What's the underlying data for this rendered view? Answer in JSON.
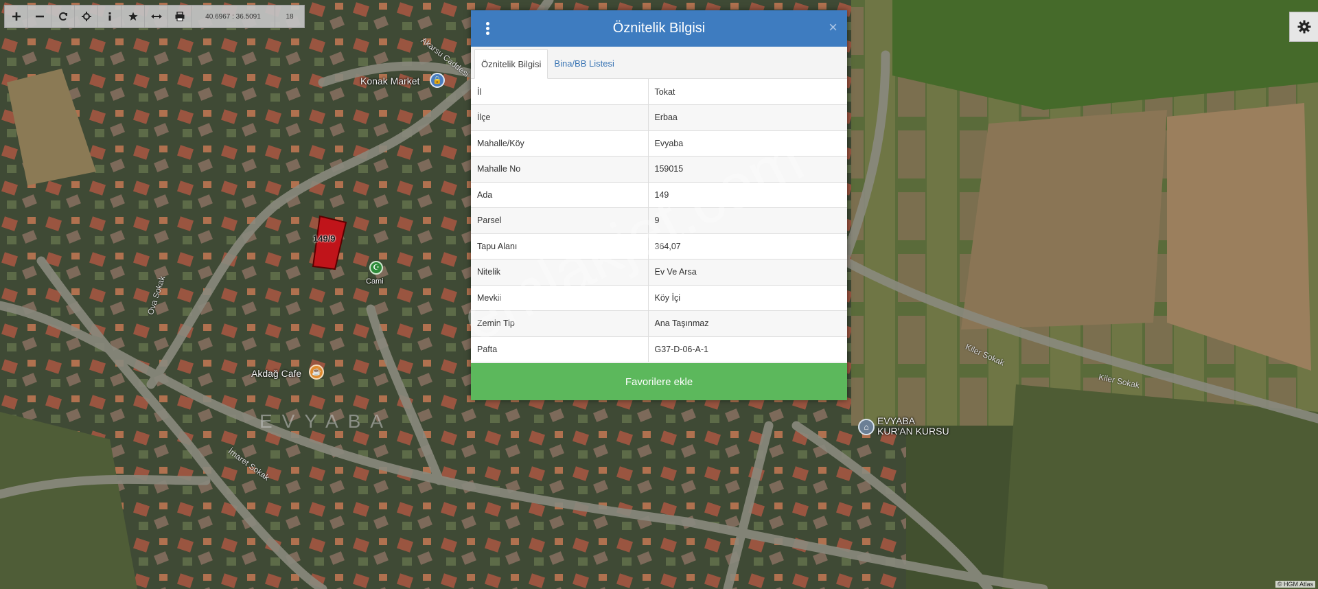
{
  "toolbar": {
    "buttons": [
      {
        "name": "zoom-in",
        "icon": "plus-icon"
      },
      {
        "name": "zoom-out",
        "icon": "minus-icon"
      },
      {
        "name": "refresh",
        "icon": "refresh-icon"
      },
      {
        "name": "locate",
        "icon": "crosshair-icon"
      },
      {
        "name": "info",
        "icon": "info-icon"
      },
      {
        "name": "favorites",
        "icon": "star-icon"
      },
      {
        "name": "measure",
        "icon": "measure-icon"
      },
      {
        "name": "print",
        "icon": "print-icon"
      }
    ],
    "coordinates": "40.6967 : 36.5091",
    "zoom_level": "18"
  },
  "map": {
    "parcel_label": "149/9",
    "places": {
      "konak_market": "Konak Market",
      "cami": "Cami",
      "akdag_cafe": "Akdağ Cafe",
      "evyaba": "EVYABA",
      "kuran_kursu_line1": "EVYABA",
      "kuran_kursu_line2": "KUR'AN KURSU"
    },
    "roads": {
      "akarsu": "Akarsu Caddesi",
      "ova": "Ova Sokak",
      "imaret": "İmaret Sokak",
      "kiler1": "Kiler Sokak",
      "kiler2": "Kiler Sokak"
    },
    "attribution": "© HGM Atlas",
    "watermark": "emlakjet.com",
    "colors": {
      "parcel_fill": "#c0141a",
      "parcel_border": "#5a0000"
    }
  },
  "dialog": {
    "title": "Öznitelik Bilgisi",
    "close_symbol": "×",
    "tabs": [
      {
        "label": "Öznitelik Bilgisi",
        "active": true
      },
      {
        "label": "Bina/BB Listesi",
        "active": false
      }
    ],
    "rows": [
      {
        "key": "İl",
        "value": "Tokat"
      },
      {
        "key": "İlçe",
        "value": "Erbaa"
      },
      {
        "key": "Mahalle/Köy",
        "value": "Evyaba"
      },
      {
        "key": "Mahalle No",
        "value": "159015"
      },
      {
        "key": "Ada",
        "value": "149"
      },
      {
        "key": "Parsel",
        "value": "9"
      },
      {
        "key": "Tapu Alanı",
        "value": "364,07"
      },
      {
        "key": "Nitelik",
        "value": "Ev Ve Arsa"
      },
      {
        "key": "Mevkii",
        "value": "Köy İçi"
      },
      {
        "key": "Zemin Tip",
        "value": "Ana Taşınmaz"
      },
      {
        "key": "Pafta",
        "value": "G37-D-06-A-1"
      }
    ],
    "favorite_button": "Favorilere ekle",
    "colors": {
      "header": "#3e7cc0",
      "button": "#5cb85c"
    }
  }
}
